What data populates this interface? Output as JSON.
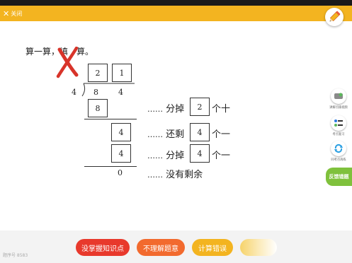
{
  "header": {
    "close_label": "关闭"
  },
  "question": {
    "prompt_start": "算一算，",
    "prompt_hidden_1": "填",
    "prompt_end": "算。"
  },
  "division": {
    "quotient_tens": "2",
    "quotient_ones": "1",
    "divisor": "4",
    "dividend_tens": "8",
    "dividend_ones": "4",
    "step1_product": "8",
    "step2_remainder_digit": "4",
    "step2_product": "4",
    "final_remainder": "0"
  },
  "explanations": {
    "dots": "……",
    "line1_pre": "分掉",
    "line1_value": "2",
    "line1_post": "个十",
    "line2_pre": "还剩",
    "line2_value": "4",
    "line2_post": "个一",
    "line3_pre": "分掉",
    "line3_value": "4",
    "line3_post": "个一",
    "line4": "没有剩余"
  },
  "sidebar": {
    "items": [
      {
        "icon": "video-icon",
        "label": "讲解点拨视频"
      },
      {
        "icon": "review-icon",
        "label": "考点复习"
      },
      {
        "icon": "refresh-icon",
        "label": "同考点再练"
      }
    ],
    "feedback_label": "反馈错题"
  },
  "footer": {
    "buttons": [
      {
        "label": "没掌握知识点",
        "color": "#e8392c"
      },
      {
        "label": "不理解题意",
        "color": "#f26a2e"
      },
      {
        "label": "计算错误",
        "color": "#f3b420"
      }
    ],
    "question_id": "题序号 8583"
  },
  "colors": {
    "accent": "#f3b420",
    "feedback": "#7fc13c",
    "wrong_mark": "#d8342a"
  }
}
